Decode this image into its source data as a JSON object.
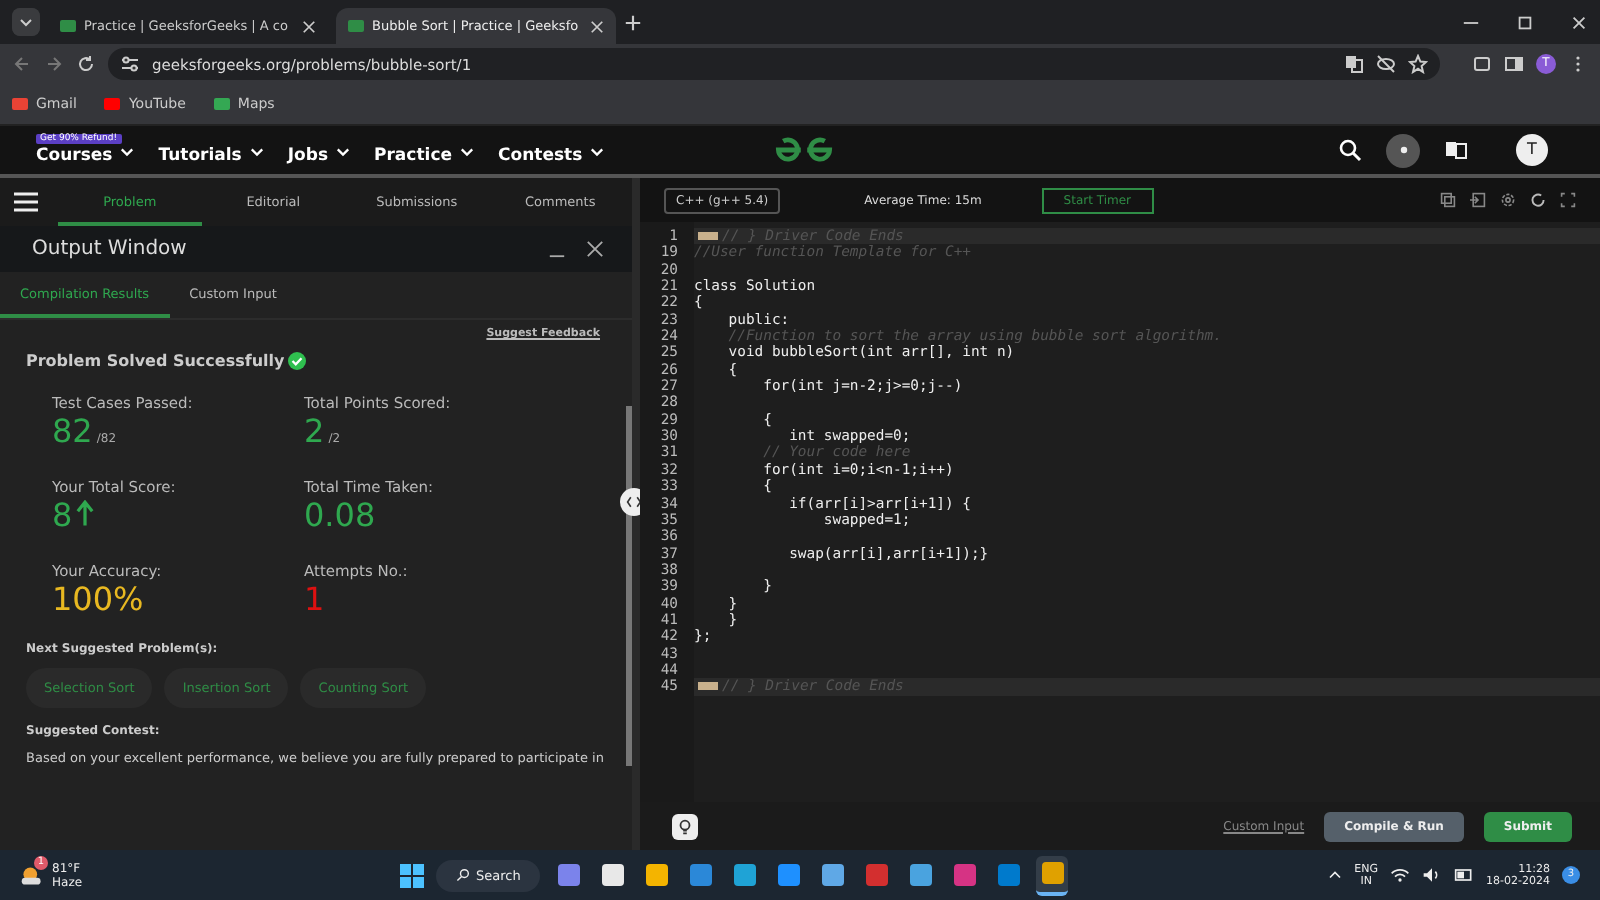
{
  "browser": {
    "tabs": [
      {
        "title": "Practice | GeeksforGeeks | A co",
        "selected": false
      },
      {
        "title": "Bubble Sort | Practice | Geeksfo",
        "selected": true
      }
    ],
    "url": "geeksforgeeks.org/problems/bubble-sort/1",
    "avatar": "T",
    "bookmarks": [
      {
        "label": "Gmail",
        "color": "#ea4335"
      },
      {
        "label": "YouTube",
        "color": "#ff0000"
      },
      {
        "label": "Maps",
        "color": "#34a853"
      }
    ]
  },
  "site": {
    "badge": "Get 90% Refund!",
    "nav": [
      "Courses",
      "Tutorials",
      "Jobs",
      "Practice",
      "Contests"
    ],
    "avatar": "T"
  },
  "problem_tabs": [
    {
      "label": "Problem",
      "selected": true
    },
    {
      "label": "Editorial",
      "selected": false
    },
    {
      "label": "Submissions",
      "selected": false
    },
    {
      "label": "Comments",
      "selected": false
    }
  ],
  "output": {
    "title": "Output Window",
    "tabs": [
      {
        "label": "Compilation Results",
        "selected": true
      },
      {
        "label": "Custom Input",
        "selected": false
      }
    ],
    "feedback": "Suggest Feedback",
    "status": "Problem Solved Successfully",
    "stats": [
      {
        "label": "Test Cases Passed:",
        "value": "82",
        "suffix": "/82",
        "color": "#2fa84f"
      },
      {
        "label": "Total Points Scored:",
        "value": "2",
        "suffix": "/2",
        "color": "#2fa84f"
      },
      {
        "label": "Your Total Score:",
        "value": "8",
        "color": "#2fa84f",
        "trend": true
      },
      {
        "label": "Total Time Taken:",
        "value": "0.08",
        "color": "#2fa84f"
      },
      {
        "label": "Your Accuracy:",
        "value": "100%",
        "color": "#e8b821"
      },
      {
        "label": "Attempts No.:",
        "value": "1",
        "color": "#dd1111"
      }
    ],
    "next_heading": "Next Suggested Problem(s):",
    "next": [
      "Selection Sort",
      "Insertion Sort",
      "Counting Sort"
    ],
    "contest_heading": "Suggested Contest:",
    "contest_text": "Based on your excellent performance, we believe you are fully prepared to participate in"
  },
  "editor": {
    "language": "C++ (g++ 5.4)",
    "average_time": "Average Time: 15m",
    "timer": "Start Timer",
    "lines": [
      {
        "n": "1",
        "kind": "folded",
        "text": "// } Driver Code Ends"
      },
      {
        "n": "19",
        "kind": "comment",
        "text": "//User function Template for C++"
      },
      {
        "n": "20",
        "kind": "code"
      },
      {
        "n": "21",
        "kind": "code",
        "text": "class Solution"
      },
      {
        "n": "22",
        "kind": "code",
        "text": "{"
      },
      {
        "n": "23",
        "kind": "code",
        "text": "    public:"
      },
      {
        "n": "24",
        "kind": "comment",
        "text": "    //Function to sort the array using bubble sort algorithm."
      },
      {
        "n": "25",
        "kind": "code",
        "text": "    void bubbleSort(int arr[], int n)"
      },
      {
        "n": "26",
        "kind": "code",
        "text": "    {"
      },
      {
        "n": "27",
        "kind": "code",
        "text": "        for(int j=n-2;j>=0;j--)"
      },
      {
        "n": "28",
        "kind": "code"
      },
      {
        "n": "29",
        "kind": "code",
        "text": "        {"
      },
      {
        "n": "30",
        "kind": "code",
        "text": "           int swapped=0;"
      },
      {
        "n": "31",
        "kind": "comment",
        "text": "        // Your code here"
      },
      {
        "n": "32",
        "kind": "code",
        "text": "        for(int i=0;i<n-1;i++)"
      },
      {
        "n": "33",
        "kind": "code",
        "text": "        {"
      },
      {
        "n": "34",
        "kind": "code",
        "text": "           if(arr[i]>arr[i+1]) {"
      },
      {
        "n": "35",
        "kind": "code",
        "text": "               swapped=1;"
      },
      {
        "n": "36",
        "kind": "code"
      },
      {
        "n": "37",
        "kind": "code",
        "text": "           swap(arr[i],arr[i+1]);}"
      },
      {
        "n": "38",
        "kind": "code"
      },
      {
        "n": "39",
        "kind": "code",
        "text": "        }"
      },
      {
        "n": "40",
        "kind": "code",
        "text": "    }"
      },
      {
        "n": "41",
        "kind": "code",
        "text": "    }"
      },
      {
        "n": "42",
        "kind": "code",
        "text": "};"
      },
      {
        "n": "43",
        "kind": "code"
      },
      {
        "n": "44",
        "kind": "code"
      },
      {
        "n": "45",
        "kind": "folded",
        "text": "// } Driver Code Ends"
      }
    ],
    "custom_input": "Custom Input",
    "compile": "Compile & Run",
    "submit": "Submit"
  },
  "taskbar": {
    "temperature": "81°F",
    "weather": "Haze",
    "weather_badge": "1",
    "search": "Search",
    "apps": [
      {
        "color": "#7b83eb",
        "selected": false
      },
      {
        "color": "#e8e8e8",
        "selected": false
      },
      {
        "color": "#f4b400",
        "selected": false
      },
      {
        "color": "#2b88d8",
        "selected": false
      },
      {
        "color": "#1fa3d6",
        "selected": false
      },
      {
        "color": "#1e90ff",
        "selected": false
      },
      {
        "color": "#5fa8e6",
        "selected": false
      },
      {
        "color": "#d32f2f",
        "selected": false
      },
      {
        "color": "#4aa3df",
        "selected": false
      },
      {
        "color": "#d63384",
        "selected": false
      },
      {
        "color": "#007acc",
        "selected": false
      },
      {
        "color": "#e0a100",
        "selected": true
      }
    ],
    "lang": "ENG",
    "region": "IN",
    "time": "11:28",
    "date": "18-02-2024",
    "notifications": "3"
  }
}
